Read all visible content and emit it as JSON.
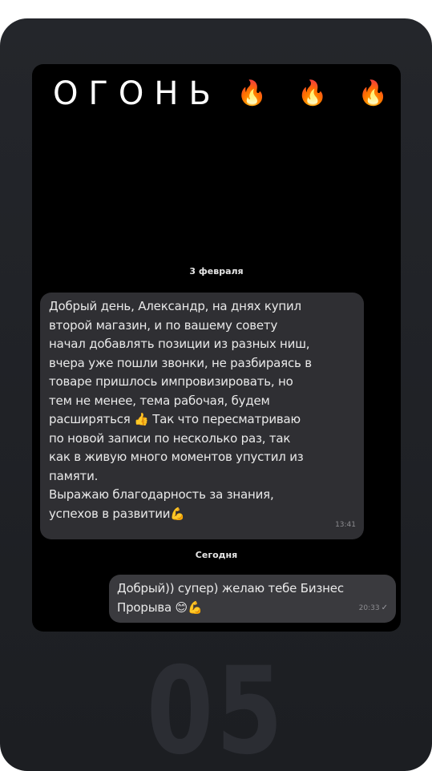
{
  "headline": {
    "text": "ОГОНЬ",
    "fire_emoji": [
      "🔥",
      "🔥",
      "🔥"
    ]
  },
  "chat": {
    "date_1": "3 февраля",
    "incoming": {
      "text": "Добрый день, Александр, на днях купил\nвторой магазин, и по вашему совету\nначал добавлять позиции из разных ниш,\nвчера уже пошли звонки, не разбираясь в\nтоваре пришлось импровизировать, но\nтем не менее, тема рабочая, будем\nрасширяться 👍 Так что пересматриваю\nпо новой записи по несколько раз, так\nкак в живую много моментов упустил из\nпамяти.\nВыражаю благодарность за знания,\nуспехов в развитии💪",
      "time": "13:41"
    },
    "date_2": "Сегодня",
    "outgoing": {
      "text": "Добрый)) супер) желаю тебе Бизнес\nПрорыва 😊💪",
      "time": "20:33",
      "status_icon": "✓"
    }
  },
  "card": {
    "number": "05"
  }
}
